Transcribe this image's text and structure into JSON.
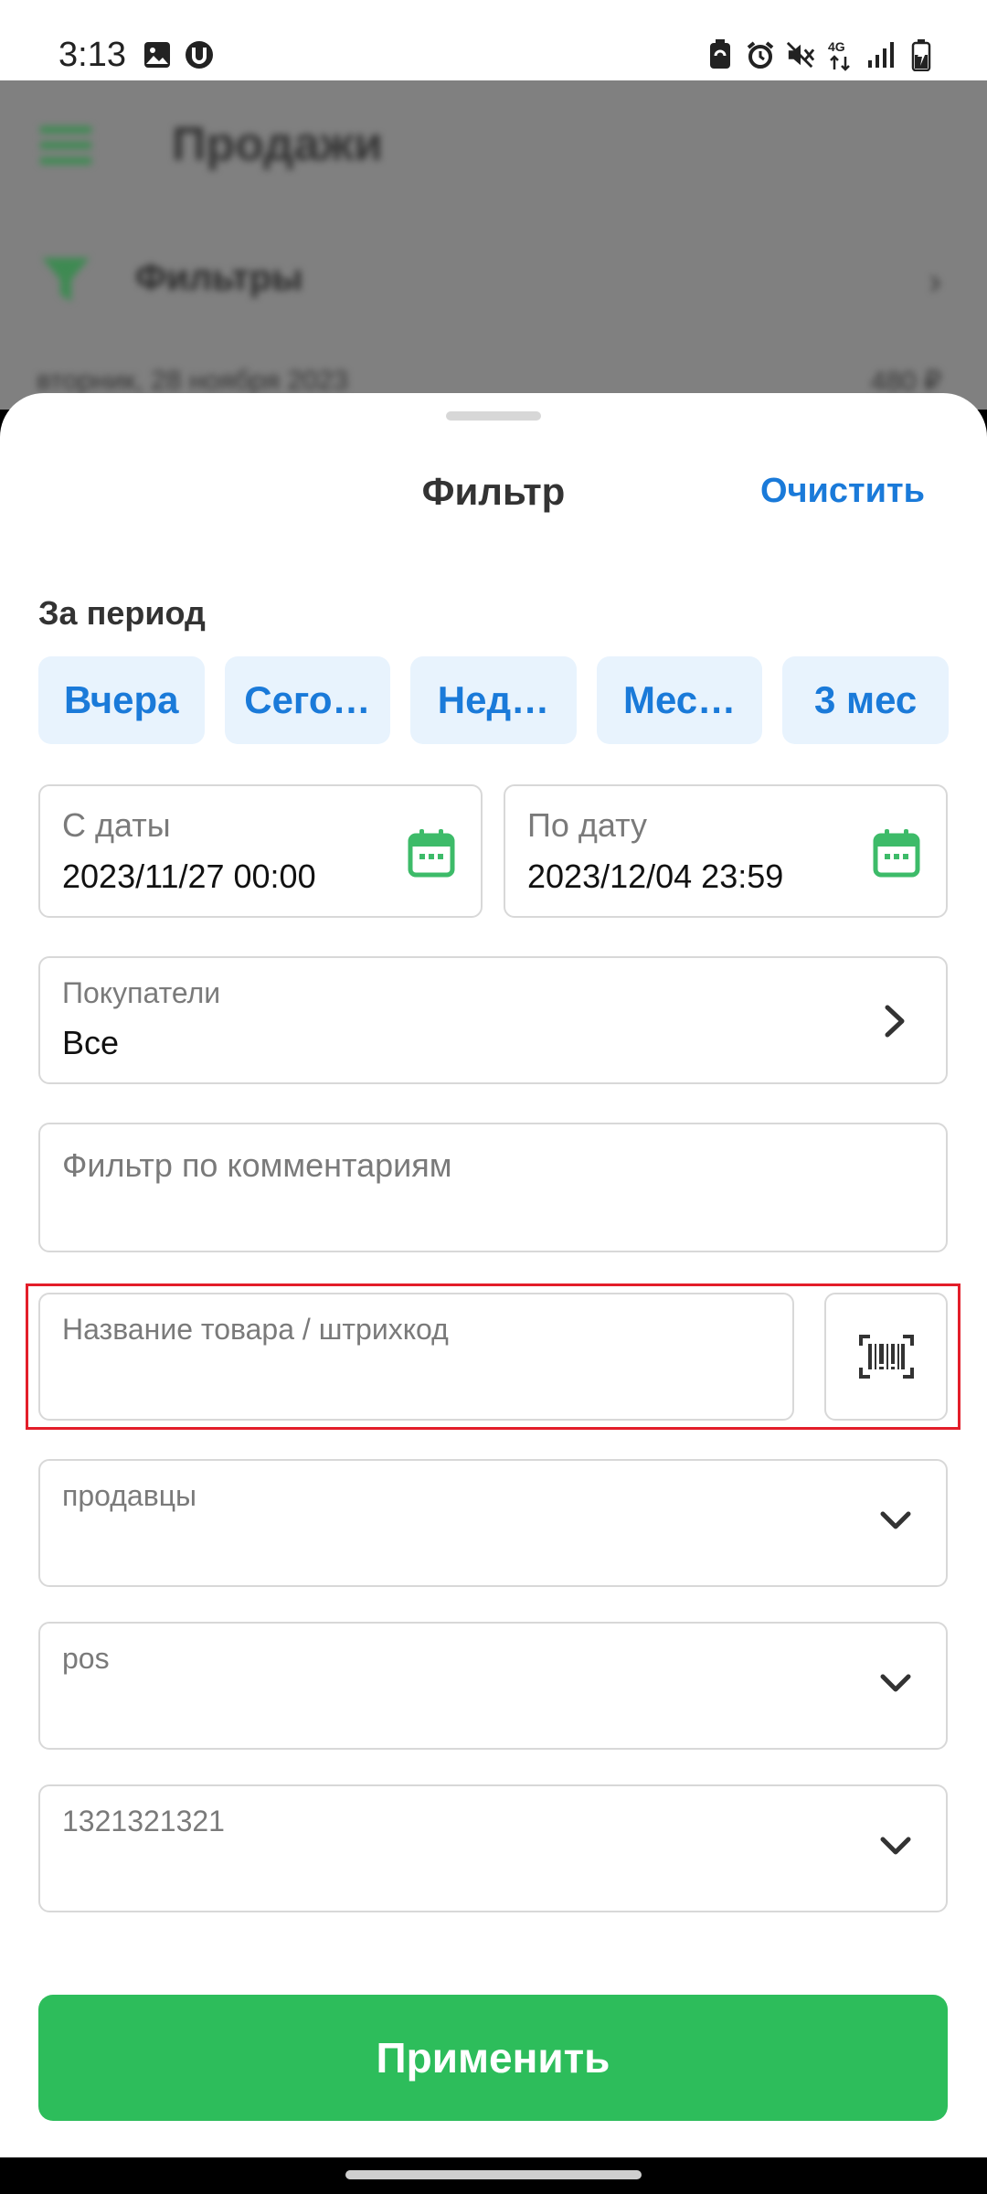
{
  "status_bar": {
    "time": "3:13",
    "left_icons": [
      "image-icon",
      "u-app-icon"
    ],
    "right_icons": [
      "battery-saver-icon",
      "alarm-icon",
      "mute-icon",
      "4g-icon",
      "signal-icon",
      "battery-icon"
    ],
    "network": "4G"
  },
  "background": {
    "title": "Продажи",
    "filters_label": "Фильтры",
    "row_text": "вторник, 28 ноября 2023",
    "row_right": "480 ₽"
  },
  "sheet": {
    "title": "Фильтр",
    "clear_label": "Очистить",
    "period_label": "За период",
    "chips": [
      {
        "label": "Вчера"
      },
      {
        "label": "Сего…"
      },
      {
        "label": "Нед…"
      },
      {
        "label": "Мес…"
      },
      {
        "label": "3 мес"
      }
    ],
    "date_from": {
      "label": "С даты",
      "value": "2023/11/27 00:00"
    },
    "date_to": {
      "label": "По дату",
      "value": "2023/12/04 23:59"
    },
    "buyers": {
      "label": "Покупатели",
      "value": "Все"
    },
    "comments": {
      "placeholder": "Фильтр по комментариям"
    },
    "product": {
      "placeholder": "Название товара / штрихкод"
    },
    "sellers": {
      "placeholder": "продавцы"
    },
    "pos": {
      "placeholder": "pos"
    },
    "number": {
      "placeholder": "1321321321"
    },
    "apply_label": "Применить"
  },
  "colors": {
    "accent_blue": "#1a7ad9",
    "chip_bg": "#e8f3fd",
    "green": "#2dbd5b",
    "highlight_red": "#e31e2a"
  }
}
